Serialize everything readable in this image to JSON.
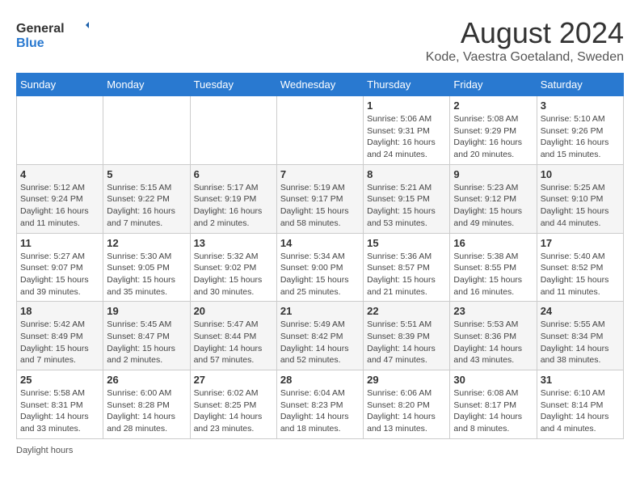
{
  "logo": {
    "text_general": "General",
    "text_blue": "Blue"
  },
  "title": "August 2024",
  "subtitle": "Kode, Vaestra Goetaland, Sweden",
  "days_of_week": [
    "Sunday",
    "Monday",
    "Tuesday",
    "Wednesday",
    "Thursday",
    "Friday",
    "Saturday"
  ],
  "weeks": [
    [
      {
        "day": "",
        "info": ""
      },
      {
        "day": "",
        "info": ""
      },
      {
        "day": "",
        "info": ""
      },
      {
        "day": "",
        "info": ""
      },
      {
        "day": "1",
        "info": "Sunrise: 5:06 AM\nSunset: 9:31 PM\nDaylight: 16 hours\nand 24 minutes."
      },
      {
        "day": "2",
        "info": "Sunrise: 5:08 AM\nSunset: 9:29 PM\nDaylight: 16 hours\nand 20 minutes."
      },
      {
        "day": "3",
        "info": "Sunrise: 5:10 AM\nSunset: 9:26 PM\nDaylight: 16 hours\nand 15 minutes."
      }
    ],
    [
      {
        "day": "4",
        "info": "Sunrise: 5:12 AM\nSunset: 9:24 PM\nDaylight: 16 hours\nand 11 minutes."
      },
      {
        "day": "5",
        "info": "Sunrise: 5:15 AM\nSunset: 9:22 PM\nDaylight: 16 hours\nand 7 minutes."
      },
      {
        "day": "6",
        "info": "Sunrise: 5:17 AM\nSunset: 9:19 PM\nDaylight: 16 hours\nand 2 minutes."
      },
      {
        "day": "7",
        "info": "Sunrise: 5:19 AM\nSunset: 9:17 PM\nDaylight: 15 hours\nand 58 minutes."
      },
      {
        "day": "8",
        "info": "Sunrise: 5:21 AM\nSunset: 9:15 PM\nDaylight: 15 hours\nand 53 minutes."
      },
      {
        "day": "9",
        "info": "Sunrise: 5:23 AM\nSunset: 9:12 PM\nDaylight: 15 hours\nand 49 minutes."
      },
      {
        "day": "10",
        "info": "Sunrise: 5:25 AM\nSunset: 9:10 PM\nDaylight: 15 hours\nand 44 minutes."
      }
    ],
    [
      {
        "day": "11",
        "info": "Sunrise: 5:27 AM\nSunset: 9:07 PM\nDaylight: 15 hours\nand 39 minutes."
      },
      {
        "day": "12",
        "info": "Sunrise: 5:30 AM\nSunset: 9:05 PM\nDaylight: 15 hours\nand 35 minutes."
      },
      {
        "day": "13",
        "info": "Sunrise: 5:32 AM\nSunset: 9:02 PM\nDaylight: 15 hours\nand 30 minutes."
      },
      {
        "day": "14",
        "info": "Sunrise: 5:34 AM\nSunset: 9:00 PM\nDaylight: 15 hours\nand 25 minutes."
      },
      {
        "day": "15",
        "info": "Sunrise: 5:36 AM\nSunset: 8:57 PM\nDaylight: 15 hours\nand 21 minutes."
      },
      {
        "day": "16",
        "info": "Sunrise: 5:38 AM\nSunset: 8:55 PM\nDaylight: 15 hours\nand 16 minutes."
      },
      {
        "day": "17",
        "info": "Sunrise: 5:40 AM\nSunset: 8:52 PM\nDaylight: 15 hours\nand 11 minutes."
      }
    ],
    [
      {
        "day": "18",
        "info": "Sunrise: 5:42 AM\nSunset: 8:49 PM\nDaylight: 15 hours\nand 7 minutes."
      },
      {
        "day": "19",
        "info": "Sunrise: 5:45 AM\nSunset: 8:47 PM\nDaylight: 15 hours\nand 2 minutes."
      },
      {
        "day": "20",
        "info": "Sunrise: 5:47 AM\nSunset: 8:44 PM\nDaylight: 14 hours\nand 57 minutes."
      },
      {
        "day": "21",
        "info": "Sunrise: 5:49 AM\nSunset: 8:42 PM\nDaylight: 14 hours\nand 52 minutes."
      },
      {
        "day": "22",
        "info": "Sunrise: 5:51 AM\nSunset: 8:39 PM\nDaylight: 14 hours\nand 47 minutes."
      },
      {
        "day": "23",
        "info": "Sunrise: 5:53 AM\nSunset: 8:36 PM\nDaylight: 14 hours\nand 43 minutes."
      },
      {
        "day": "24",
        "info": "Sunrise: 5:55 AM\nSunset: 8:34 PM\nDaylight: 14 hours\nand 38 minutes."
      }
    ],
    [
      {
        "day": "25",
        "info": "Sunrise: 5:58 AM\nSunset: 8:31 PM\nDaylight: 14 hours\nand 33 minutes."
      },
      {
        "day": "26",
        "info": "Sunrise: 6:00 AM\nSunset: 8:28 PM\nDaylight: 14 hours\nand 28 minutes."
      },
      {
        "day": "27",
        "info": "Sunrise: 6:02 AM\nSunset: 8:25 PM\nDaylight: 14 hours\nand 23 minutes."
      },
      {
        "day": "28",
        "info": "Sunrise: 6:04 AM\nSunset: 8:23 PM\nDaylight: 14 hours\nand 18 minutes."
      },
      {
        "day": "29",
        "info": "Sunrise: 6:06 AM\nSunset: 8:20 PM\nDaylight: 14 hours\nand 13 minutes."
      },
      {
        "day": "30",
        "info": "Sunrise: 6:08 AM\nSunset: 8:17 PM\nDaylight: 14 hours\nand 8 minutes."
      },
      {
        "day": "31",
        "info": "Sunrise: 6:10 AM\nSunset: 8:14 PM\nDaylight: 14 hours\nand 4 minutes."
      }
    ]
  ],
  "footer": "Daylight hours"
}
